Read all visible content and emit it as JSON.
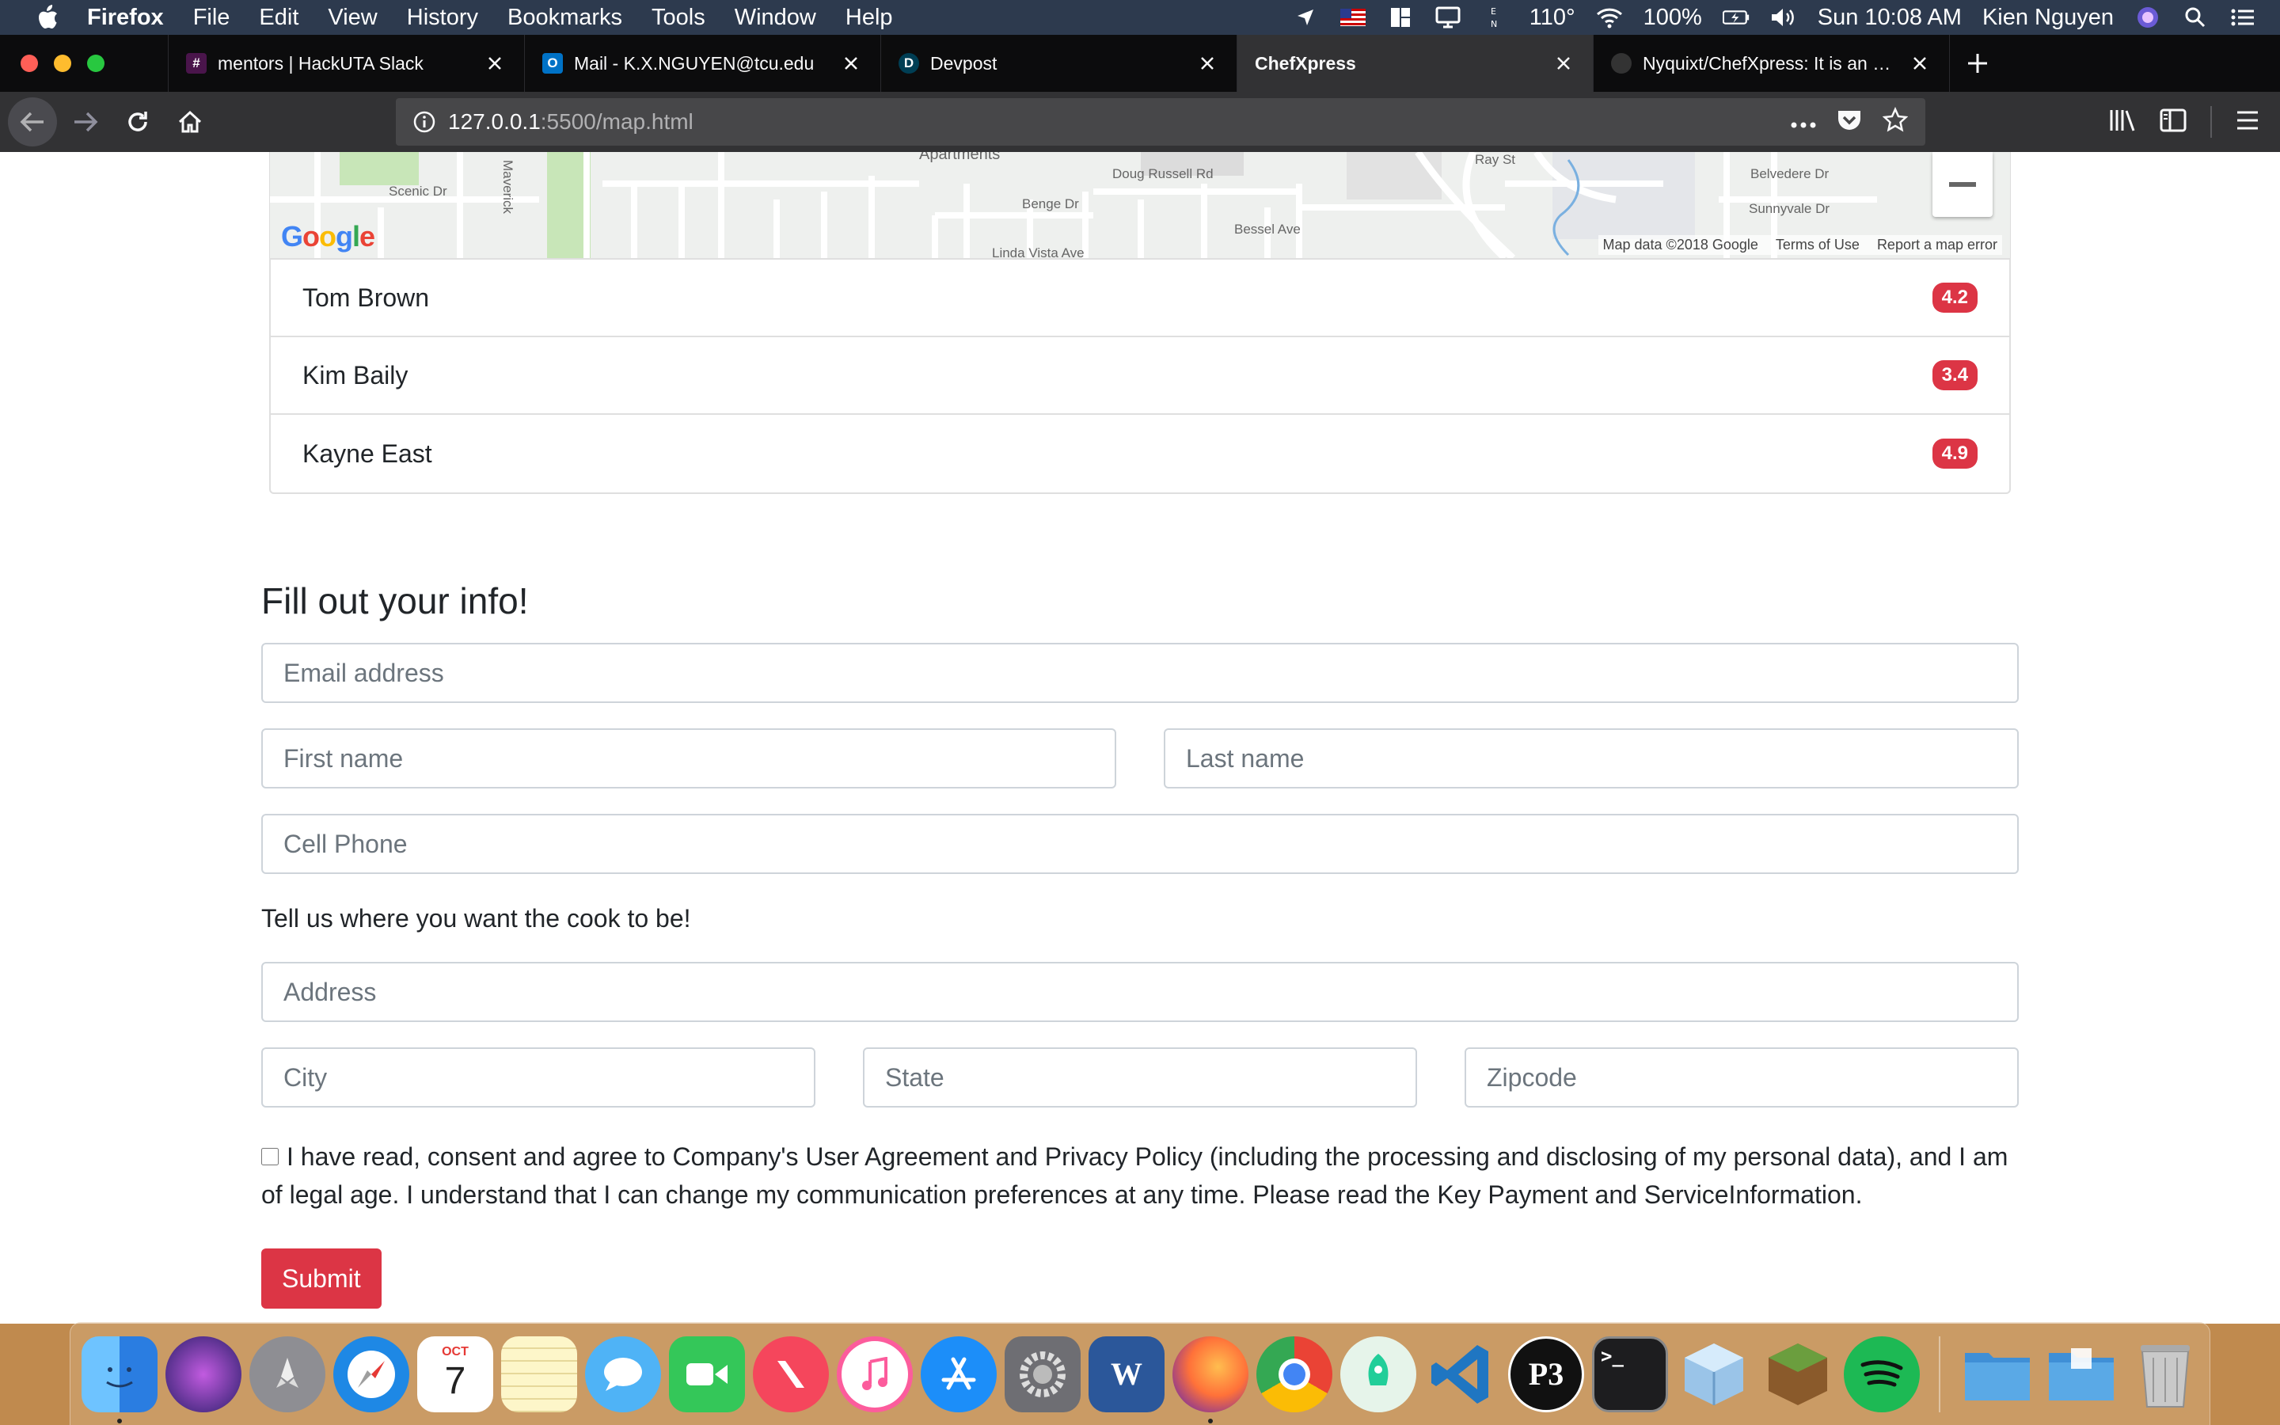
{
  "menubar": {
    "app_name": "Firefox",
    "items": [
      "File",
      "Edit",
      "View",
      "History",
      "Bookmarks",
      "Tools",
      "Window",
      "Help"
    ],
    "status": {
      "temperature": "110°",
      "battery": "100%",
      "clock": "Sun 10:08 AM",
      "user": "Kien Nguyen"
    }
  },
  "tabs": [
    {
      "title": "mentors | HackUTA Slack",
      "favicon": "#",
      "favicon_color": "#4a154b"
    },
    {
      "title": "Mail - K.X.NGUYEN@tcu.edu",
      "favicon": "O",
      "favicon_color": "#0072c6"
    },
    {
      "title": "Devpost",
      "favicon": "D",
      "favicon_color": "#003e54"
    },
    {
      "title": "ChefXpress",
      "favicon": "",
      "favicon_color": ""
    },
    {
      "title": "Nyquixt/ChefXpress: It is an ube",
      "favicon": "",
      "favicon_color": "#333"
    }
  ],
  "address_bar": {
    "host": "127.0.0.1",
    "path": ":5500/map.html"
  },
  "map": {
    "streets": [
      "Scenic Dr",
      "Maverick",
      "Doug Russell Rd",
      "Benge Dr",
      "Bessel Ave",
      "Linda Vista Ave",
      "Ray St",
      "Belvedere Dr",
      "Sunnyvale Dr",
      "Apartments"
    ],
    "attribution": [
      "Map data ©2018 Google",
      "Terms of Use",
      "Report a map error"
    ],
    "logo": "Google"
  },
  "cooks": [
    {
      "name": "Tom Brown",
      "rating": "4.2"
    },
    {
      "name": "Kim Baily",
      "rating": "3.4"
    },
    {
      "name": "Kayne East",
      "rating": "4.9"
    }
  ],
  "form": {
    "heading": "Fill out your info!",
    "email_placeholder": "Email address",
    "first_name_placeholder": "First name",
    "last_name_placeholder": "Last name",
    "phone_placeholder": "Cell Phone",
    "location_prompt": "Tell us where you want the cook to be!",
    "address_placeholder": "Address",
    "city_placeholder": "City",
    "state_placeholder": "State",
    "zip_placeholder": "Zipcode",
    "consent_text": "I have read, consent and agree to Company's User Agreement and Privacy Policy (including the processing and disclosing of my personal data), and I am of legal age. I understand that I can change my communication preferences at any time. Please read the Key Payment and ServiceInformation.",
    "submit_label": "Submit"
  },
  "colors": {
    "accent": "#dc3545",
    "menubar_bg": "#2d3a4e",
    "tabstrip_bg": "#0c0c0d"
  },
  "dock": {
    "apps": [
      {
        "icon": "finder-icon",
        "color": "#3d8fe6"
      },
      {
        "icon": "siri-icon",
        "color": "#5a3bb0"
      },
      {
        "icon": "launchpad-icon",
        "color": "#8e8e93"
      },
      {
        "icon": "safari-icon",
        "color": "#1e88e5"
      },
      {
        "icon": "calendar-icon",
        "color": "#ffffff"
      },
      {
        "icon": "notes-icon",
        "color": "#f7d44c"
      },
      {
        "icon": "messages-icon",
        "color": "#4fb3f6"
      },
      {
        "icon": "facetime-icon",
        "color": "#34c759"
      },
      {
        "icon": "news-icon",
        "color": "#f5465c"
      },
      {
        "icon": "itunes-icon",
        "color": "#fc5c9c"
      },
      {
        "icon": "app-store-icon",
        "color": "#1c8ef9"
      },
      {
        "icon": "system-preferences-icon",
        "color": "#6e6e73"
      },
      {
        "icon": "word-icon",
        "color": "#2b579a"
      },
      {
        "icon": "firefox-icon",
        "color": "#ff7139"
      },
      {
        "icon": "chrome-icon",
        "color": "#fbbc05"
      },
      {
        "icon": "robinhood-icon",
        "color": "#21ce99"
      },
      {
        "icon": "vscode-icon",
        "color": "#1f76c2"
      },
      {
        "icon": "p3-icon",
        "color": "#111111"
      },
      {
        "icon": "terminal-icon",
        "color": "#1d1d1f"
      },
      {
        "icon": "virtualbox-icon",
        "color": "#9ac4e8"
      },
      {
        "icon": "minecraft-icon",
        "color": "#6b9e3e"
      },
      {
        "icon": "spotify-icon",
        "color": "#1db954"
      }
    ],
    "folders": [
      {
        "icon": "folder-icon",
        "color": "#5aa9e6"
      },
      {
        "icon": "downloads-folder-icon",
        "color": "#5aa9e6"
      },
      {
        "icon": "trash-icon",
        "color": "#b5b5b5"
      }
    ],
    "calendar": {
      "month": "OCT",
      "day": "7"
    },
    "word_letter": "W",
    "p3_letter": "P3",
    "terminal_prompt": ">_"
  }
}
